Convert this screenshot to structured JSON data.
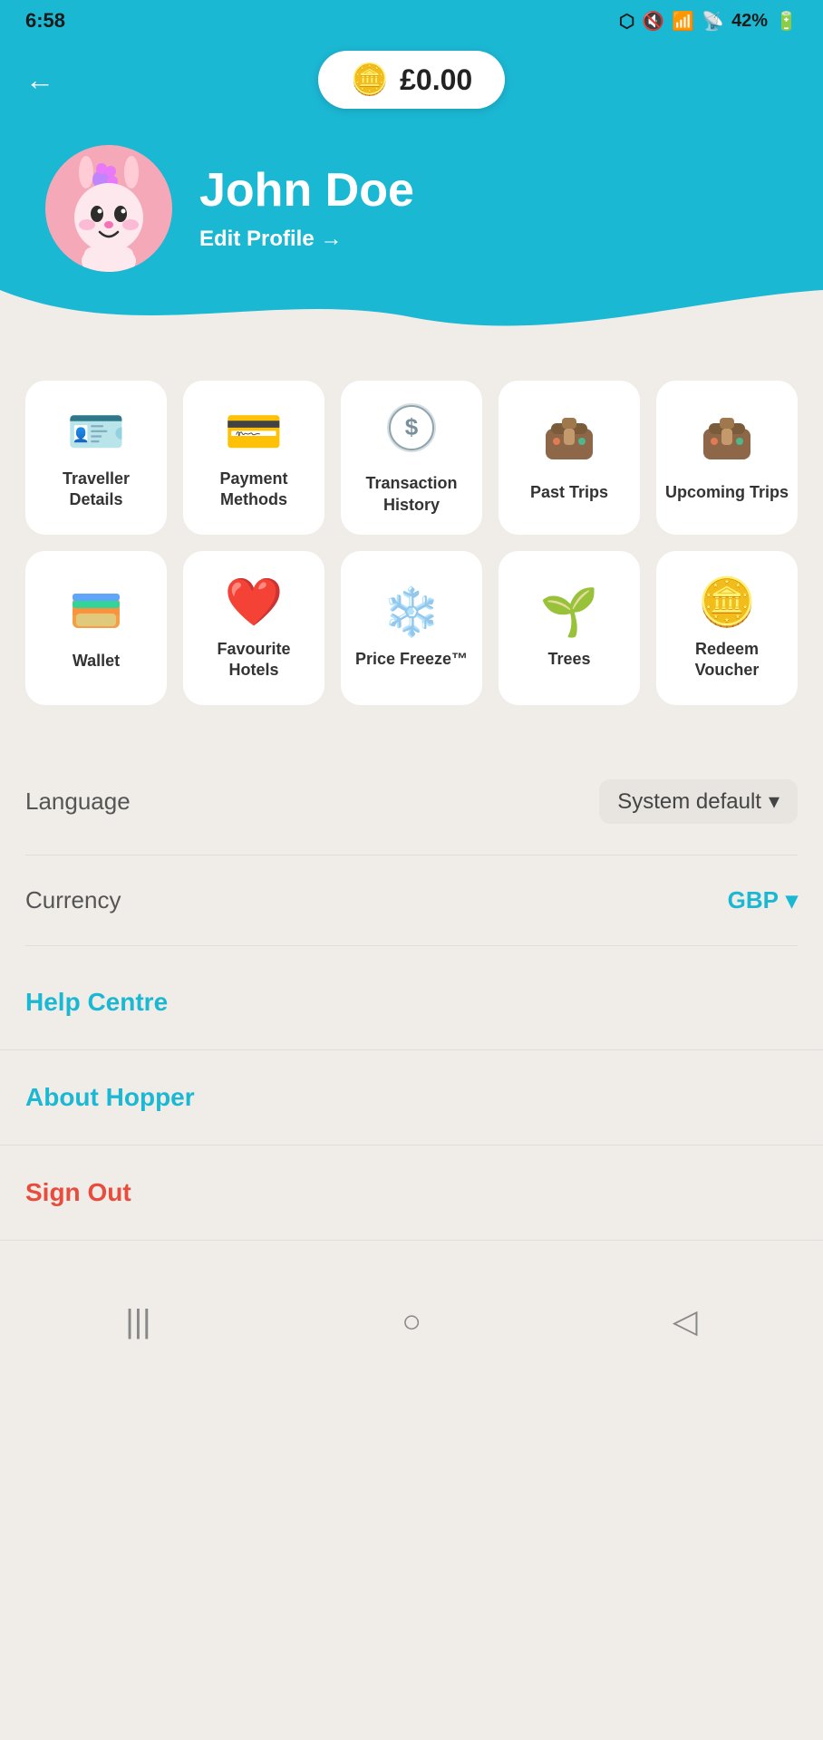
{
  "statusBar": {
    "time": "6:58",
    "batteryPercent": "42%",
    "icons": [
      "bluetooth",
      "mute",
      "wifi",
      "signal",
      "battery"
    ]
  },
  "header": {
    "backLabel": "←",
    "balance": "£0.00",
    "coinIcon": "🪙"
  },
  "profile": {
    "name": "John Doe",
    "editProfileLabel": "Edit Profile →"
  },
  "menuItems": [
    {
      "id": "traveller-details",
      "label": "Traveller Details",
      "icon": "🪪"
    },
    {
      "id": "payment-methods",
      "label": "Payment Methods",
      "icon": "💳"
    },
    {
      "id": "transaction-history",
      "label": "Transaction History",
      "icon": "💲"
    },
    {
      "id": "past-trips",
      "label": "Past Trips",
      "icon": "🧳"
    },
    {
      "id": "upcoming-trips",
      "label": "Upcoming Trips",
      "icon": "🧳"
    },
    {
      "id": "wallet",
      "label": "Wallet",
      "icon": "👛"
    },
    {
      "id": "favourite-hotels",
      "label": "Favourite Hotels",
      "icon": "❤️"
    },
    {
      "id": "price-freeze",
      "label": "Price Freeze™",
      "icon": "❄️"
    },
    {
      "id": "trees",
      "label": "Trees",
      "icon": "🌱"
    },
    {
      "id": "redeem-voucher",
      "label": "Redeem Voucher",
      "icon": "🪙"
    }
  ],
  "settings": {
    "languageLabel": "Language",
    "languageValue": "System default",
    "currencyLabel": "Currency",
    "currencyValue": "GBP",
    "dropdownIcon": "▾"
  },
  "links": {
    "helpCentre": "Help Centre",
    "aboutHopper": "About Hopper",
    "signOut": "Sign Out"
  },
  "bottomNav": {
    "backNav": "◁",
    "homeNav": "○",
    "recentNav": "|||"
  }
}
